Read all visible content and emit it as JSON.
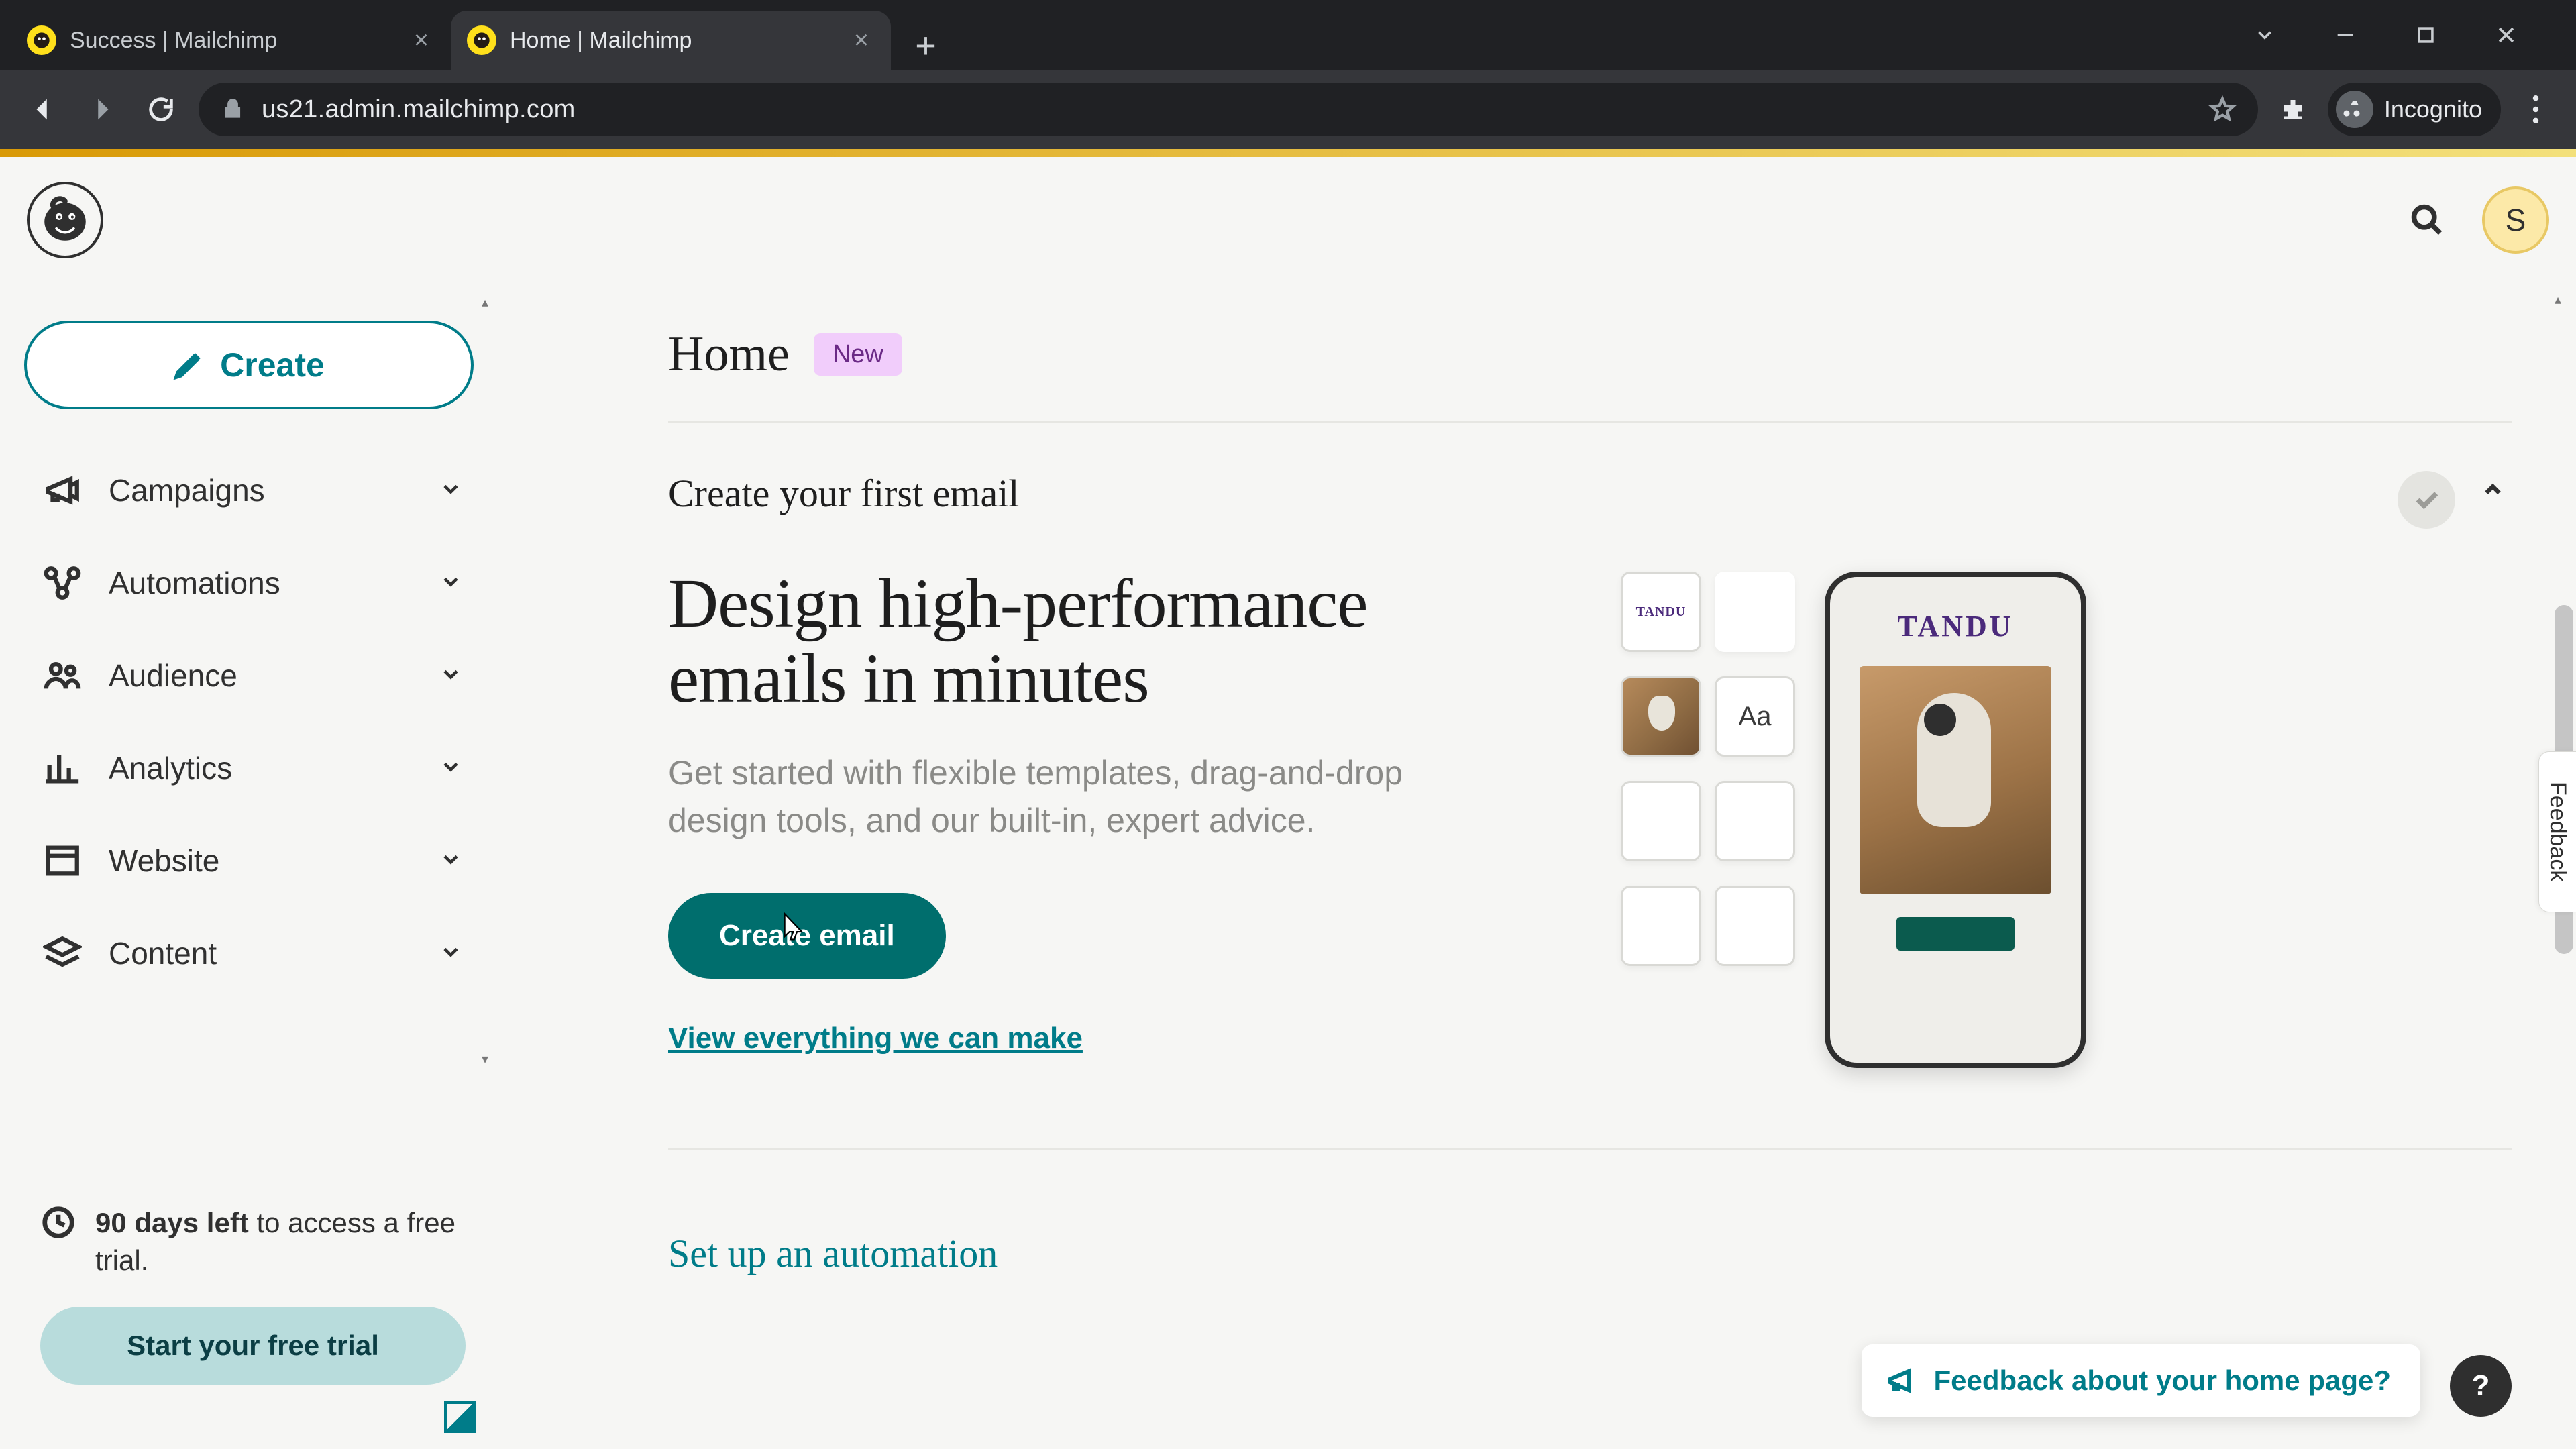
{
  "browser": {
    "tabs": [
      {
        "title": "Success | Mailchimp"
      },
      {
        "title": "Home | Mailchimp"
      }
    ],
    "url_host": "us21.admin.mailchimp.com",
    "incognito_label": "Incognito"
  },
  "header": {
    "avatar_initial": "S"
  },
  "sidebar": {
    "create_label": "Create",
    "items": [
      {
        "label": "Campaigns"
      },
      {
        "label": "Automations"
      },
      {
        "label": "Audience"
      },
      {
        "label": "Analytics"
      },
      {
        "label": "Website"
      },
      {
        "label": "Content"
      }
    ],
    "trial": {
      "days_phrase": "90 days left",
      "tail": " to access a free trial.",
      "cta": "Start your free trial"
    }
  },
  "main": {
    "title": "Home",
    "badge": "New",
    "card1": {
      "eyebrow": "Create your first email",
      "heading_line1": "Design high-performance",
      "heading_line2": "emails in minutes",
      "body": "Get started with flexible templates, drag-and-drop design tools, and our built-in, expert advice.",
      "cta": "Create email",
      "link": "View everything we can make",
      "palette_aa": "Aa",
      "brand_name": "TANDU"
    },
    "card2": {
      "eyebrow": "Set up an automation"
    },
    "feedback": "Feedback about your home page?",
    "feedback_tab": "Feedback",
    "help": "?"
  }
}
